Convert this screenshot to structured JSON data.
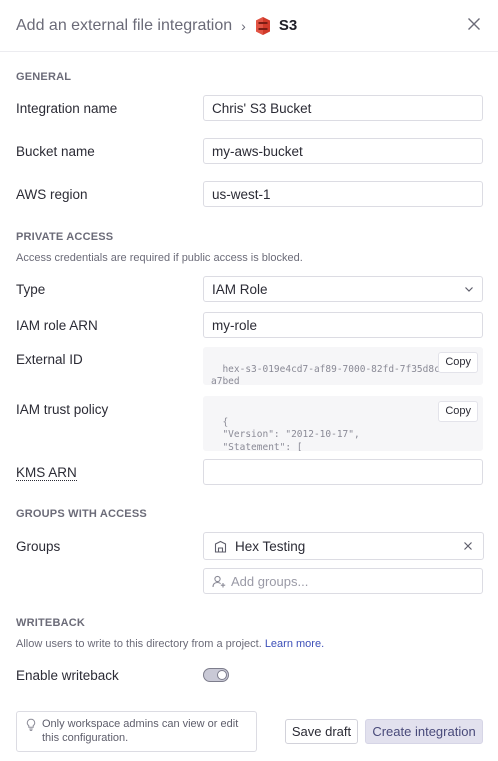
{
  "header": {
    "title": "Add an external file integration",
    "separator": "›",
    "provider": "S3"
  },
  "general": {
    "section_title": "GENERAL",
    "integration_name": {
      "label": "Integration name",
      "value": "Chris' S3 Bucket"
    },
    "bucket_name": {
      "label": "Bucket name",
      "value": "my-aws-bucket"
    },
    "aws_region": {
      "label": "AWS region",
      "value": "us-west-1"
    }
  },
  "private_access": {
    "section_title": "PRIVATE ACCESS",
    "description": "Access credentials are required if public access is blocked.",
    "type": {
      "label": "Type",
      "value": "IAM Role"
    },
    "iam_role_arn": {
      "label": "IAM role ARN",
      "value": "my-role"
    },
    "external_id": {
      "label": "External ID",
      "value": "hex-s3-019e4cd7-af89-7000-82fd-7f35d8c\na7bed",
      "copy_label": "Copy"
    },
    "iam_trust_policy": {
      "label": "IAM trust policy",
      "value": "{\n  \"Version\": \"2012-10-17\",\n  \"Statement\": [\n    {",
      "copy_label": "Copy"
    },
    "kms_arn": {
      "label": "KMS ARN",
      "value": ""
    }
  },
  "groups": {
    "section_title": "GROUPS WITH ACCESS",
    "label": "Groups",
    "selected": "Hex Testing",
    "add_placeholder": "Add groups..."
  },
  "writeback": {
    "section_title": "WRITEBACK",
    "description": "Allow users to write to this directory from a project.",
    "learn_more": "Learn more.",
    "enable_label": "Enable writeback",
    "enabled": true
  },
  "footer": {
    "note": "Only workspace admins can view or edit this configuration.",
    "save_draft": "Save draft",
    "create": "Create integration"
  },
  "colors": {
    "accent": "#494a7a",
    "s3_red": "#d13a2a"
  },
  "icons": [
    "s3-logo-icon",
    "close-icon",
    "chevron-down-icon",
    "group-icon",
    "remove-icon",
    "add-user-icon",
    "lightbulb-icon"
  ]
}
